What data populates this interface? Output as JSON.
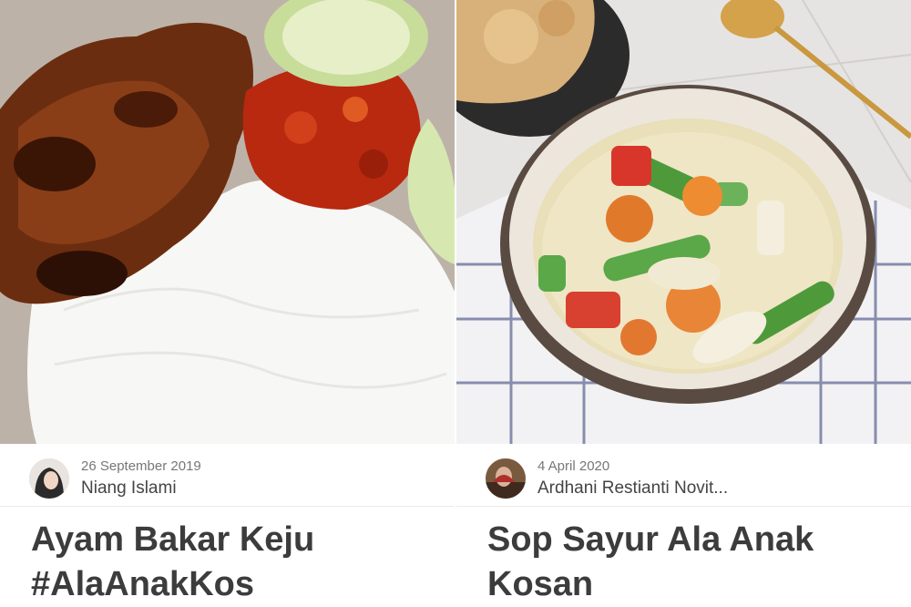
{
  "cards": [
    {
      "date": "26 September 2019",
      "author": "Niang Islami",
      "title_line1": "Ayam Bakar Keju",
      "title_line2": "#AlaAnakKos"
    },
    {
      "date": "4 April 2020",
      "author": "Ardhani Restianti Novit...",
      "title_line1": "Sop Sayur Ala Anak",
      "title_line2": "Kosan"
    }
  ],
  "icons": {
    "avatar_left": "user-avatar-icon",
    "avatar_right": "user-avatar-icon"
  }
}
